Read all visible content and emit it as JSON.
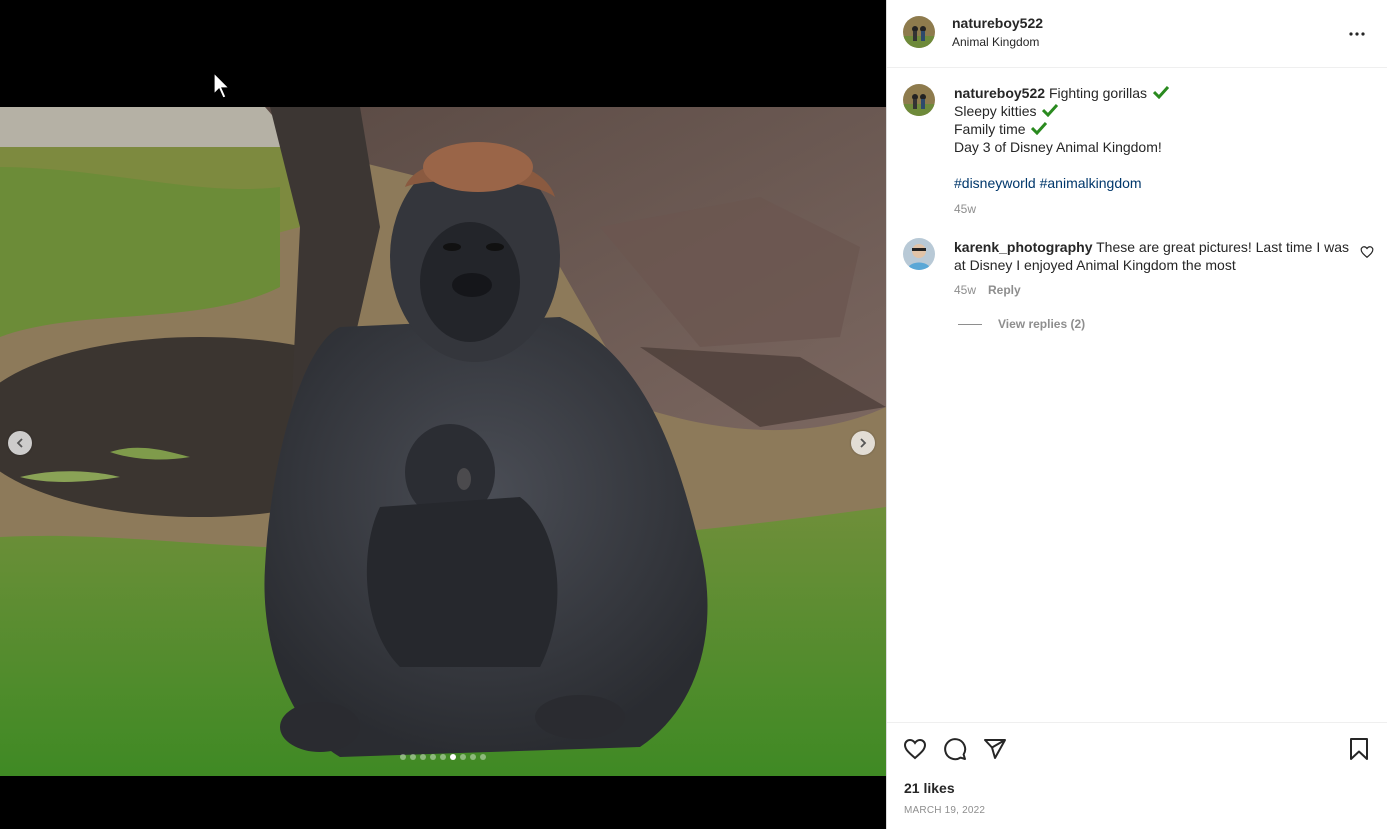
{
  "post": {
    "username": "natureboy522",
    "location": "Animal Kingdom",
    "more_icon": "more-horizontal-icon"
  },
  "caption": {
    "username": "natureboy522",
    "line1": "Fighting gorillas",
    "line2": "Sleepy kitties",
    "line3": "Family time",
    "line4": "Day 3 of Disney Animal Kingdom!",
    "hashtag1": "#disneyworld",
    "hashtag2": "#animalkingdom",
    "age": "45w",
    "check_color": "#2a8a1f"
  },
  "comment": {
    "username": "karenk_photography",
    "text": "These are great pictures! Last time I was at Disney I enjoyed Animal Kingdom the most",
    "age": "45w",
    "reply_label": "Reply",
    "view_replies": "View replies (2)"
  },
  "carousel": {
    "dot_count": 9,
    "active_index": 5
  },
  "footer": {
    "likes": "21 likes",
    "date": "MARCH 19, 2022"
  },
  "colors": {
    "link": "#00376b",
    "muted": "#8e8e8e",
    "text": "#262626"
  }
}
